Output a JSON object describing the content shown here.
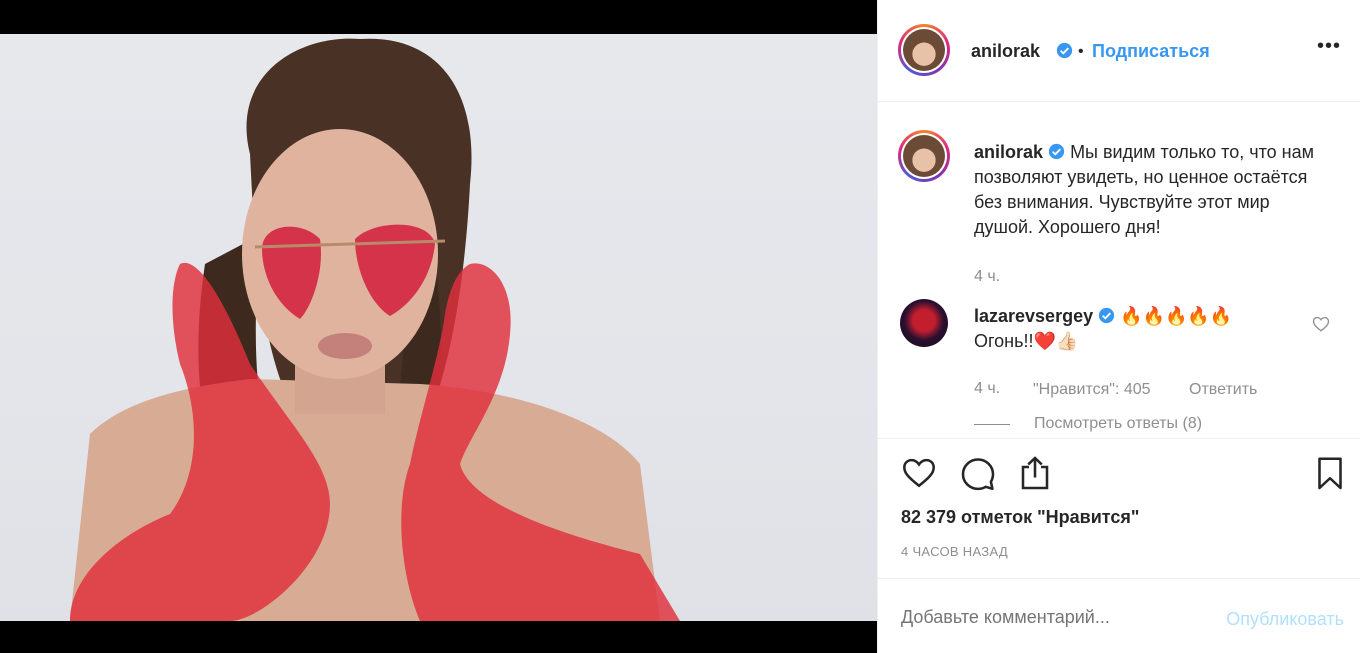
{
  "post": {
    "username": "anilorak",
    "follow_label": "Подписаться",
    "separator": "•",
    "more_label": "•••",
    "caption": "Мы видим только то, что нам позволяют увидеть, но ценное остаётся без внимания. Чувствуйте этот мир душой. Хорошего дня!",
    "caption_time": "4 ч."
  },
  "comment": {
    "username": "lazarevsergey",
    "line1": "🔥🔥🔥🔥🔥",
    "line2": "Огонь!!❤️👍🏻",
    "time": "4 ч.",
    "likes": "\"Нравится\": 405",
    "reply": "Ответить",
    "view_replies": "Посмотреть ответы (8)"
  },
  "stats": {
    "likes": "82 379 отметок \"Нравится\"",
    "posted": "4 ЧАСОВ НАЗАД"
  },
  "composer": {
    "placeholder": "Добавьте комментарий...",
    "publish": "Опубликовать"
  },
  "colors": {
    "accent": "#3897f0",
    "verified": "#3897f0",
    "muted": "#8e8e8e"
  },
  "icons": [
    "verified-badge-icon",
    "heart-icon",
    "comment-icon",
    "share-icon",
    "bookmark-icon",
    "more-icon"
  ]
}
